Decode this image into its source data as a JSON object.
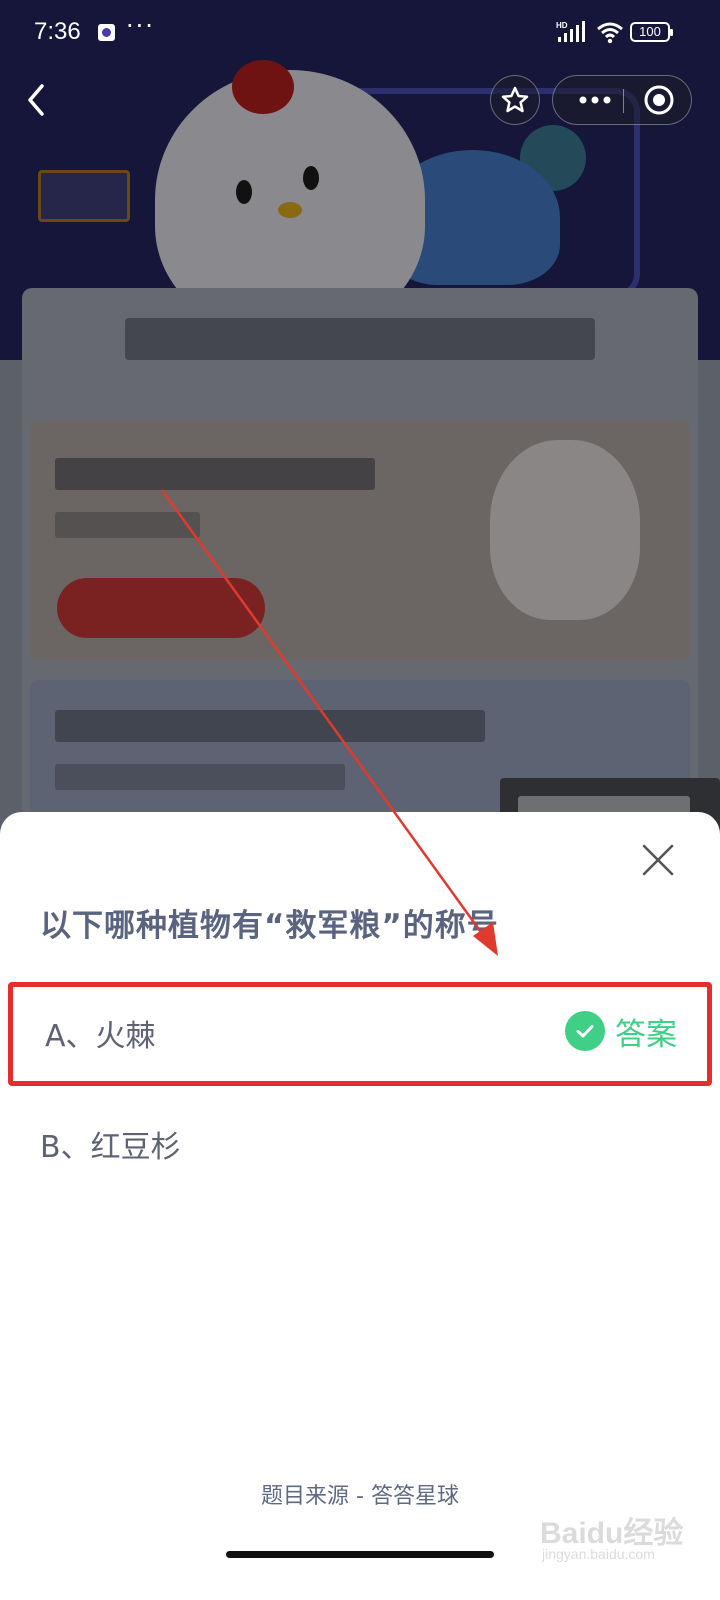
{
  "status_bar": {
    "time": "7:36",
    "more": "···",
    "battery": "100"
  },
  "quiz": {
    "question": "以下哪种植物有“救军粮”的称号",
    "options": [
      {
        "label": "A、火棘",
        "is_answer": true
      },
      {
        "label": "B、红豆杉",
        "is_answer": false
      }
    ],
    "answer_badge": "答案"
  },
  "footer": {
    "source": "题目来源 - 答答星球"
  },
  "watermark": {
    "main": "Baidu经验",
    "sub": "jingyan.baidu.com"
  },
  "colors": {
    "highlight_box": "#e72c2c",
    "answer_green": "#3fcf86",
    "question_text": "#5a6480",
    "arrow": "#e03a2e"
  },
  "icons": [
    "back-icon",
    "star-icon",
    "more-icon",
    "target-close-icon",
    "close-icon",
    "check-icon",
    "signal-icon",
    "wifi-icon",
    "battery-icon"
  ]
}
